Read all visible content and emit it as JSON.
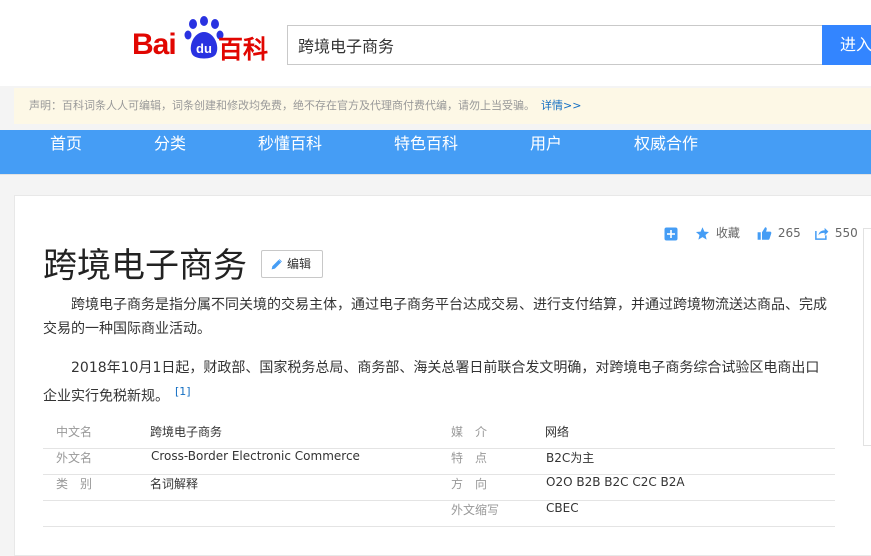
{
  "header": {
    "logo_bai": "Bai",
    "logo_du": "du",
    "logo_baike": "百科",
    "search_value": "跨境电子商务",
    "search_button": "进入"
  },
  "notice": {
    "text": "声明：百科词条人人可编辑，词条创建和修改均免费，绝不存在官方及代理商付费代编，请勿上当受骗。",
    "more_link": "详情>>"
  },
  "nav": {
    "items": [
      "首页",
      "分类",
      "秒懂百科",
      "特色百科",
      "用户",
      "权威合作"
    ]
  },
  "toolbar": {
    "collect_label": "收藏",
    "like_count": "265",
    "share_count": "550"
  },
  "article": {
    "title": "跨境电子商务",
    "edit_label": "编辑",
    "paragraph1": "跨境电子商务是指分属不同关境的交易主体，通过电子商务平台达成交易、进行支付结算，并通过跨境物流送达商品、完成交易的一种国际商业活动。",
    "paragraph2": "2018年10月1日起，财政部、国家税务总局、商务部、海关总署日前联合发文明确，对跨境电子商务综合试验区电商出口企业实行免税新规。",
    "paragraph2_ref": "[1]"
  },
  "infobox": {
    "left": [
      {
        "label": "中文名",
        "value": "跨境电子商务"
      },
      {
        "label": "外文名",
        "value": "Cross-Border Electronic Commerce"
      },
      {
        "label": "类　别",
        "value": "名词解释"
      }
    ],
    "right": [
      {
        "label": "媒　介",
        "value": "网络"
      },
      {
        "label": "特　点",
        "value": "B2C为主"
      },
      {
        "label": "方　向",
        "value": "O2O B2B B2C C2C B2A"
      },
      {
        "label": "外文缩写",
        "value": "CBEC"
      }
    ]
  },
  "colors": {
    "brand_red": "#e10601",
    "brand_blue": "#2932e1",
    "nav_blue": "#459df5",
    "button_blue": "#3385ff",
    "link_blue": "#136ec2"
  }
}
